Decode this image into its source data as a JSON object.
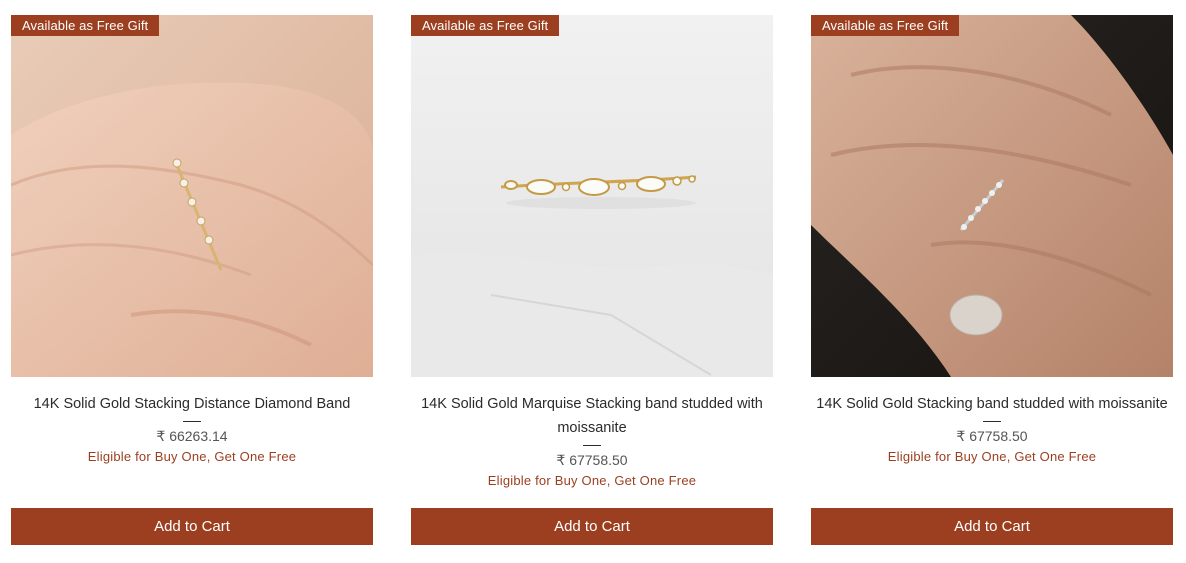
{
  "products": [
    {
      "badge": "Available as Free Gift",
      "title": "14K Solid Gold Stacking Distance Diamond Band",
      "price": "₹ 66263.14",
      "offer": "Eligible for Buy One, Get One Free",
      "button": "Add to Cart"
    },
    {
      "badge": "Available as Free Gift",
      "title": "14K Solid Gold Marquise Stacking band studded with moissanite",
      "price": "₹ 67758.50",
      "offer": "Eligible for Buy One, Get One Free",
      "button": "Add to Cart"
    },
    {
      "badge": "Available as Free Gift",
      "title": "14K Solid Gold Stacking band studded with moissanite",
      "price": "₹ 67758.50",
      "offer": "Eligible for Buy One, Get One Free",
      "button": "Add to Cart"
    }
  ],
  "colors": {
    "accent": "#9c3f20",
    "button_text": "#ffffff",
    "title_text": "#2b2b2b",
    "price_text": "#555555"
  }
}
